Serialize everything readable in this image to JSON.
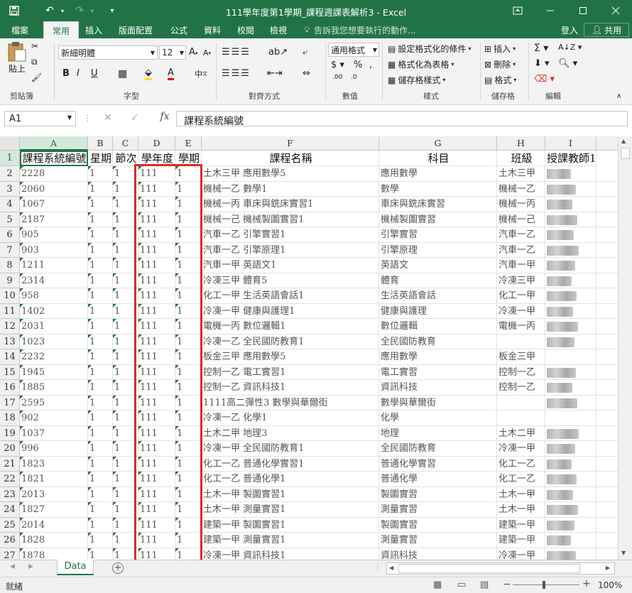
{
  "window": {
    "title": "111學年度第1學期_課程週課表解析3 - Excel"
  },
  "tabs": [
    "檔案",
    "常用",
    "插入",
    "版面配置",
    "公式",
    "資料",
    "校閱",
    "檢視"
  ],
  "tell_me": "告訴我您想要執行的動作...",
  "signin": "登入",
  "share": "共用",
  "ribbon": {
    "paste": "貼上",
    "clipboard": "剪貼簿",
    "font_name": "新細明體",
    "font_size": "12",
    "font_group": "字型",
    "align_group": "對齊方式",
    "number_format": "通用格式",
    "number_group": "數值",
    "cond_format": "設定格式化的條件",
    "format_table": "格式化為表格",
    "cell_styles": "儲存格樣式",
    "styles_group": "樣式",
    "insert": "插入",
    "delete": "刪除",
    "format": "格式",
    "cells_group": "儲存格",
    "edit_group": "編輯"
  },
  "formula_bar": {
    "name_box": "A1",
    "formula": "課程系統編號",
    "fx": "fx"
  },
  "columns": [
    "A",
    "B",
    "C",
    "D",
    "E",
    "F",
    "G",
    "H",
    "I"
  ],
  "headers": [
    "課程系統編號",
    "星期",
    "節次",
    "學年度",
    "學期",
    "課程名稱",
    "科目",
    "班級",
    "授課教師1"
  ],
  "rows": [
    {
      "r": "2",
      "a": "2228",
      "f": "土木三甲 應用數學5",
      "g": "應用數學",
      "h": "土木三甲"
    },
    {
      "r": "3",
      "a": "2060",
      "f": "機械一乙 數學1",
      "g": "數學",
      "h": "機械一乙"
    },
    {
      "r": "4",
      "a": "1067",
      "f": "機械一丙 車床與銑床實習1",
      "g": "車床與銑床實習",
      "h": "機械一丙"
    },
    {
      "r": "5",
      "a": "2187",
      "f": "機械一己 機械製圖實習1",
      "g": "機械製圖實習",
      "h": "機械一己"
    },
    {
      "r": "6",
      "a": "905",
      "f": "汽車一乙 引擎實習1",
      "g": "引擎實習",
      "h": "汽車一乙"
    },
    {
      "r": "7",
      "a": "903",
      "f": "汽車一乙 引擎原理1",
      "g": "引擎原理",
      "h": "汽車一乙"
    },
    {
      "r": "8",
      "a": "1211",
      "f": "汽車一甲 英語文1",
      "g": "英語文",
      "h": "汽車一甲"
    },
    {
      "r": "9",
      "a": "2314",
      "f": "冷凍三甲 體育5",
      "g": "體育",
      "h": "冷凍三甲"
    },
    {
      "r": "10",
      "a": "958",
      "f": "化工一甲 生活英語會話1",
      "g": "生活英語會話",
      "h": "化工一甲"
    },
    {
      "r": "11",
      "a": "1402",
      "f": "冷凍一甲 健康與護理1",
      "g": "健康與護理",
      "h": "冷凍一甲"
    },
    {
      "r": "12",
      "a": "2031",
      "f": "電機一丙 數位邏輯1",
      "g": "數位邏輯",
      "h": "電機一丙"
    },
    {
      "r": "13",
      "a": "1023",
      "f": "冷凍一乙 全民國防教育1",
      "g": "全民國防教育",
      "h": ""
    },
    {
      "r": "14",
      "a": "2232",
      "f": "板金三甲 應用數學5",
      "g": "應用數學",
      "h": "板金三甲"
    },
    {
      "r": "15",
      "a": "1945",
      "f": "控制一乙 電工實習1",
      "g": "電工實習",
      "h": "控制一乙"
    },
    {
      "r": "16",
      "a": "1885",
      "f": "控制一乙 資訊科技1",
      "g": "資訊科技",
      "h": "控制一乙"
    },
    {
      "r": "17",
      "a": "2595",
      "f": "1111高二彈性3 數學與華爾街",
      "g": "數學與華爾街",
      "h": ""
    },
    {
      "r": "18",
      "a": "902",
      "f": "冷凍一乙 化學1",
      "g": "化學",
      "h": ""
    },
    {
      "r": "19",
      "a": "1037",
      "f": "土木二甲 地理3",
      "g": "地理",
      "h": "土木二甲"
    },
    {
      "r": "20",
      "a": "996",
      "f": "冷凍一甲 全民國防教育1",
      "g": "全民國防教育",
      "h": "冷凍一甲"
    },
    {
      "r": "21",
      "a": "1823",
      "f": "化工一乙 普通化學實習1",
      "g": "普通化學實習",
      "h": "化工一乙"
    },
    {
      "r": "22",
      "a": "1821",
      "f": "化工一乙 普通化學1",
      "g": "普通化學",
      "h": "化工一乙"
    },
    {
      "r": "23",
      "a": "2013",
      "f": "土木一甲 製圖實習1",
      "g": "製圖實習",
      "h": "土木一甲"
    },
    {
      "r": "24",
      "a": "1827",
      "f": "土木一甲 測量實習1",
      "g": "測量實習",
      "h": "土木一甲"
    },
    {
      "r": "25",
      "a": "2014",
      "f": "建築一甲 製圖實習1",
      "g": "製圖實習",
      "h": "建築一甲"
    },
    {
      "r": "26",
      "a": "1828",
      "f": "建築一甲 測量實習1",
      "g": "測量實習",
      "h": "建築一甲"
    },
    {
      "r": "27",
      "a": "1878",
      "f": "冷凍一甲 資訊科技1",
      "g": "資訊科技",
      "h": "冷凍一甲"
    }
  ],
  "default_b": "1",
  "default_c": "1",
  "default_d": "111",
  "default_e": "1",
  "sheet_tab": "Data",
  "status": {
    "ready": "就緒",
    "zoom": "100%"
  }
}
